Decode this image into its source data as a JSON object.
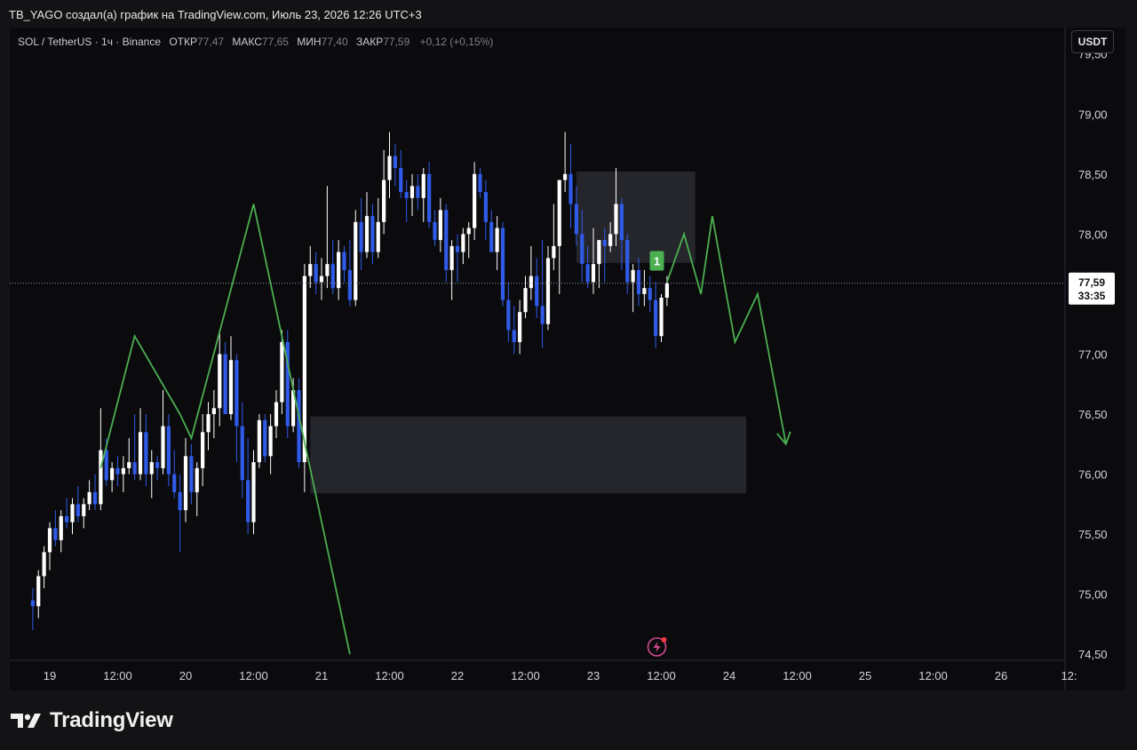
{
  "caption": "TB_YAGO создал(а) график на TradingView.com, Июль 23, 2026 12:26 UTC+3",
  "legend": {
    "symbol": "SOL / TetherUS · 1ч · Binance",
    "open_label": "ОТКР",
    "open_value": "77,47",
    "high_label": "МАКС",
    "high_value": "77,65",
    "low_label": "МИН",
    "low_value": "77,40",
    "close_label": "ЗАКР",
    "close_value": "77,59",
    "change": "+0,12 (+0,15%)"
  },
  "currency_button": "USDT",
  "price_tag": {
    "price": "77,59",
    "countdown": "33:35"
  },
  "marker_label": "1",
  "brand": "TradingView",
  "colors": {
    "up": "#ffffff",
    "down": "#2f5be8",
    "projection": "#4caf50",
    "zone": "#2a2b31",
    "marker": "#4caf50",
    "background": "#0b0b0e"
  },
  "chart_data": {
    "type": "candlestick",
    "y_ticks": [
      "79,50",
      "79,00",
      "78,50",
      "78,00",
      "77,00",
      "76,50",
      "76,00",
      "75,50",
      "75,00",
      "74,50"
    ],
    "y_tick_values": [
      79.5,
      79.0,
      78.5,
      78.0,
      77.0,
      76.5,
      76.0,
      75.5,
      75.0,
      74.5
    ],
    "ylim": [
      74.45,
      79.72
    ],
    "x_ticks": [
      "19",
      "12:00",
      "20",
      "12:00",
      "21",
      "12:00",
      "22",
      "12:00",
      "23",
      "12:00",
      "24",
      "12:00",
      "25",
      "12:00",
      "26",
      "12:"
    ],
    "x_tick_hours": [
      0,
      12,
      24,
      36,
      48,
      60,
      72,
      84,
      96,
      108,
      120,
      132,
      144,
      156,
      168,
      180
    ],
    "xlim_hours": [
      -3,
      180
    ],
    "current_price": 77.59,
    "candles": [
      {
        "t": -3,
        "o": 74.95,
        "h": 75.05,
        "l": 74.7,
        "c": 74.9
      },
      {
        "t": -2,
        "o": 74.9,
        "h": 75.2,
        "l": 74.8,
        "c": 75.15
      },
      {
        "t": -1,
        "o": 75.15,
        "h": 75.4,
        "l": 75.05,
        "c": 75.35
      },
      {
        "t": 0,
        "o": 75.35,
        "h": 75.6,
        "l": 75.2,
        "c": 75.55
      },
      {
        "t": 1,
        "o": 75.55,
        "h": 75.7,
        "l": 75.4,
        "c": 75.45
      },
      {
        "t": 2,
        "o": 75.45,
        "h": 75.7,
        "l": 75.35,
        "c": 75.65
      },
      {
        "t": 3,
        "o": 75.65,
        "h": 75.8,
        "l": 75.55,
        "c": 75.6
      },
      {
        "t": 4,
        "o": 75.6,
        "h": 75.8,
        "l": 75.5,
        "c": 75.75
      },
      {
        "t": 5,
        "o": 75.75,
        "h": 75.9,
        "l": 75.6,
        "c": 75.65
      },
      {
        "t": 6,
        "o": 75.65,
        "h": 75.8,
        "l": 75.55,
        "c": 75.75
      },
      {
        "t": 7,
        "o": 75.75,
        "h": 75.95,
        "l": 75.7,
        "c": 75.85
      },
      {
        "t": 8,
        "o": 75.85,
        "h": 76.0,
        "l": 75.7,
        "c": 75.75
      },
      {
        "t": 9,
        "o": 75.75,
        "h": 76.55,
        "l": 75.7,
        "c": 76.2
      },
      {
        "t": 10,
        "o": 76.2,
        "h": 76.3,
        "l": 75.9,
        "c": 75.95
      },
      {
        "t": 11,
        "o": 75.95,
        "h": 76.1,
        "l": 75.85,
        "c": 76.05
      },
      {
        "t": 12,
        "o": 76.05,
        "h": 76.15,
        "l": 75.9,
        "c": 76.0
      },
      {
        "t": 13,
        "o": 76.0,
        "h": 76.15,
        "l": 75.85,
        "c": 76.05
      },
      {
        "t": 14,
        "o": 76.05,
        "h": 76.3,
        "l": 76.0,
        "c": 76.1
      },
      {
        "t": 15,
        "o": 76.1,
        "h": 76.5,
        "l": 75.95,
        "c": 76.0
      },
      {
        "t": 16,
        "o": 76.0,
        "h": 76.55,
        "l": 75.95,
        "c": 76.35
      },
      {
        "t": 17,
        "o": 76.35,
        "h": 76.5,
        "l": 75.9,
        "c": 76.0
      },
      {
        "t": 18,
        "o": 76.0,
        "h": 76.2,
        "l": 75.8,
        "c": 76.1
      },
      {
        "t": 19,
        "o": 76.1,
        "h": 76.15,
        "l": 75.95,
        "c": 76.05
      },
      {
        "t": 20,
        "o": 76.05,
        "h": 76.7,
        "l": 76.0,
        "c": 76.4
      },
      {
        "t": 21,
        "o": 76.4,
        "h": 76.5,
        "l": 75.9,
        "c": 76.0
      },
      {
        "t": 22,
        "o": 76.0,
        "h": 76.2,
        "l": 75.8,
        "c": 75.85
      },
      {
        "t": 23,
        "o": 75.85,
        "h": 76.0,
        "l": 75.35,
        "c": 75.7
      },
      {
        "t": 24,
        "o": 75.7,
        "h": 76.3,
        "l": 75.6,
        "c": 76.15
      },
      {
        "t": 25,
        "o": 76.15,
        "h": 76.25,
        "l": 75.75,
        "c": 75.85
      },
      {
        "t": 26,
        "o": 75.85,
        "h": 76.1,
        "l": 75.65,
        "c": 76.05
      },
      {
        "t": 27,
        "o": 76.05,
        "h": 76.5,
        "l": 75.9,
        "c": 76.35
      },
      {
        "t": 28,
        "o": 76.35,
        "h": 76.6,
        "l": 76.2,
        "c": 76.5
      },
      {
        "t": 29,
        "o": 76.5,
        "h": 76.7,
        "l": 76.3,
        "c": 76.55
      },
      {
        "t": 30,
        "o": 76.55,
        "h": 77.2,
        "l": 76.4,
        "c": 77.0
      },
      {
        "t": 31,
        "o": 77.0,
        "h": 77.1,
        "l": 76.5,
        "c": 76.5
      },
      {
        "t": 32,
        "o": 76.5,
        "h": 77.15,
        "l": 76.45,
        "c": 76.95
      },
      {
        "t": 33,
        "o": 76.95,
        "h": 77.0,
        "l": 76.1,
        "c": 76.4
      },
      {
        "t": 34,
        "o": 76.4,
        "h": 76.6,
        "l": 75.8,
        "c": 75.95
      },
      {
        "t": 35,
        "o": 75.95,
        "h": 76.3,
        "l": 75.5,
        "c": 75.6
      },
      {
        "t": 36,
        "o": 75.6,
        "h": 76.2,
        "l": 75.5,
        "c": 76.1
      },
      {
        "t": 37,
        "o": 76.1,
        "h": 76.5,
        "l": 76.05,
        "c": 76.45
      },
      {
        "t": 38,
        "o": 76.45,
        "h": 76.5,
        "l": 76.1,
        "c": 76.15
      },
      {
        "t": 39,
        "o": 76.15,
        "h": 76.5,
        "l": 76.0,
        "c": 76.4
      },
      {
        "t": 40,
        "o": 76.4,
        "h": 76.7,
        "l": 76.3,
        "c": 76.6
      },
      {
        "t": 41,
        "o": 76.6,
        "h": 77.2,
        "l": 76.5,
        "c": 77.1
      },
      {
        "t": 42,
        "o": 77.1,
        "h": 77.2,
        "l": 76.3,
        "c": 76.4
      },
      {
        "t": 43,
        "o": 76.4,
        "h": 76.8,
        "l": 76.35,
        "c": 76.7
      },
      {
        "t": 44,
        "o": 76.7,
        "h": 76.8,
        "l": 76.05,
        "c": 76.1
      },
      {
        "t": 45,
        "o": 76.1,
        "h": 77.75,
        "l": 75.85,
        "c": 77.65
      },
      {
        "t": 46,
        "o": 77.65,
        "h": 77.9,
        "l": 77.55,
        "c": 77.75
      },
      {
        "t": 47,
        "o": 77.75,
        "h": 77.85,
        "l": 77.5,
        "c": 77.6
      },
      {
        "t": 48,
        "o": 77.6,
        "h": 77.8,
        "l": 77.45,
        "c": 77.65
      },
      {
        "t": 49,
        "o": 77.65,
        "h": 78.4,
        "l": 77.55,
        "c": 77.75
      },
      {
        "t": 50,
        "o": 77.75,
        "h": 77.95,
        "l": 77.5,
        "c": 77.55
      },
      {
        "t": 51,
        "o": 77.55,
        "h": 77.95,
        "l": 77.45,
        "c": 77.85
      },
      {
        "t": 52,
        "o": 77.85,
        "h": 77.9,
        "l": 77.6,
        "c": 77.7
      },
      {
        "t": 53,
        "o": 77.7,
        "h": 77.95,
        "l": 77.4,
        "c": 77.45
      },
      {
        "t": 54,
        "o": 77.45,
        "h": 78.2,
        "l": 77.4,
        "c": 78.1
      },
      {
        "t": 55,
        "o": 78.1,
        "h": 78.3,
        "l": 77.7,
        "c": 77.85
      },
      {
        "t": 56,
        "o": 77.85,
        "h": 78.35,
        "l": 77.8,
        "c": 78.15
      },
      {
        "t": 57,
        "o": 78.15,
        "h": 78.25,
        "l": 77.75,
        "c": 77.85
      },
      {
        "t": 58,
        "o": 77.85,
        "h": 78.3,
        "l": 77.8,
        "c": 78.1
      },
      {
        "t": 59,
        "o": 78.1,
        "h": 78.7,
        "l": 78.0,
        "c": 78.45
      },
      {
        "t": 60,
        "o": 78.45,
        "h": 78.85,
        "l": 78.3,
        "c": 78.65
      },
      {
        "t": 61,
        "o": 78.65,
        "h": 78.75,
        "l": 78.4,
        "c": 78.55
      },
      {
        "t": 62,
        "o": 78.55,
        "h": 78.7,
        "l": 78.3,
        "c": 78.35
      },
      {
        "t": 63,
        "o": 78.35,
        "h": 78.45,
        "l": 78.1,
        "c": 78.3
      },
      {
        "t": 64,
        "o": 78.3,
        "h": 78.5,
        "l": 78.15,
        "c": 78.4
      },
      {
        "t": 65,
        "o": 78.4,
        "h": 78.5,
        "l": 78.2,
        "c": 78.3
      },
      {
        "t": 66,
        "o": 78.3,
        "h": 78.55,
        "l": 78.1,
        "c": 78.5
      },
      {
        "t": 67,
        "o": 78.5,
        "h": 78.6,
        "l": 78.05,
        "c": 78.1
      },
      {
        "t": 68,
        "o": 78.1,
        "h": 78.2,
        "l": 77.9,
        "c": 77.95
      },
      {
        "t": 69,
        "o": 77.95,
        "h": 78.3,
        "l": 77.85,
        "c": 78.2
      },
      {
        "t": 70,
        "o": 78.2,
        "h": 78.25,
        "l": 77.6,
        "c": 77.7
      },
      {
        "t": 71,
        "o": 77.7,
        "h": 77.95,
        "l": 77.45,
        "c": 77.9
      },
      {
        "t": 72,
        "o": 77.9,
        "h": 78.0,
        "l": 77.6,
        "c": 77.85
      },
      {
        "t": 73,
        "o": 77.85,
        "h": 78.05,
        "l": 77.75,
        "c": 78.0
      },
      {
        "t": 74,
        "o": 78.0,
        "h": 78.1,
        "l": 77.8,
        "c": 78.05
      },
      {
        "t": 75,
        "o": 78.05,
        "h": 78.6,
        "l": 77.95,
        "c": 78.5
      },
      {
        "t": 76,
        "o": 78.5,
        "h": 78.55,
        "l": 78.3,
        "c": 78.35
      },
      {
        "t": 77,
        "o": 78.35,
        "h": 78.45,
        "l": 77.95,
        "c": 78.1
      },
      {
        "t": 78,
        "o": 78.1,
        "h": 78.2,
        "l": 77.85,
        "c": 77.85
      },
      {
        "t": 79,
        "o": 77.85,
        "h": 78.15,
        "l": 77.7,
        "c": 78.05
      },
      {
        "t": 80,
        "o": 78.05,
        "h": 78.1,
        "l": 77.4,
        "c": 77.45
      },
      {
        "t": 81,
        "o": 77.45,
        "h": 77.6,
        "l": 77.1,
        "c": 77.2
      },
      {
        "t": 82,
        "o": 77.2,
        "h": 77.4,
        "l": 77.0,
        "c": 77.1
      },
      {
        "t": 83,
        "o": 77.1,
        "h": 77.45,
        "l": 77.0,
        "c": 77.35
      },
      {
        "t": 84,
        "o": 77.35,
        "h": 77.65,
        "l": 77.3,
        "c": 77.55
      },
      {
        "t": 85,
        "o": 77.55,
        "h": 77.9,
        "l": 77.45,
        "c": 77.65
      },
      {
        "t": 86,
        "o": 77.65,
        "h": 77.8,
        "l": 77.3,
        "c": 77.4
      },
      {
        "t": 87,
        "o": 77.4,
        "h": 77.95,
        "l": 77.05,
        "c": 77.25
      },
      {
        "t": 88,
        "o": 77.25,
        "h": 77.9,
        "l": 77.2,
        "c": 77.8
      },
      {
        "t": 89,
        "o": 77.8,
        "h": 78.25,
        "l": 77.7,
        "c": 77.9
      },
      {
        "t": 90,
        "o": 77.9,
        "h": 78.35,
        "l": 77.5,
        "c": 78.45
      },
      {
        "t": 91,
        "o": 78.45,
        "h": 78.85,
        "l": 78.35,
        "c": 78.5
      },
      {
        "t": 92,
        "o": 78.5,
        "h": 78.75,
        "l": 78.05,
        "c": 78.25
      },
      {
        "t": 93,
        "o": 78.25,
        "h": 78.4,
        "l": 77.9,
        "c": 78.0
      },
      {
        "t": 94,
        "o": 78.0,
        "h": 78.2,
        "l": 77.6,
        "c": 77.75
      },
      {
        "t": 95,
        "o": 77.75,
        "h": 77.9,
        "l": 77.55,
        "c": 77.6
      },
      {
        "t": 96,
        "o": 77.6,
        "h": 78.05,
        "l": 77.5,
        "c": 77.75
      },
      {
        "t": 97,
        "o": 77.75,
        "h": 77.9,
        "l": 77.55,
        "c": 77.95
      },
      {
        "t": 98,
        "o": 77.95,
        "h": 78.05,
        "l": 77.6,
        "c": 77.9
      },
      {
        "t": 99,
        "o": 77.9,
        "h": 78.1,
        "l": 77.85,
        "c": 78.0
      },
      {
        "t": 100,
        "o": 78.0,
        "h": 78.55,
        "l": 77.9,
        "c": 78.25
      },
      {
        "t": 101,
        "o": 78.25,
        "h": 78.3,
        "l": 77.7,
        "c": 77.95
      },
      {
        "t": 102,
        "o": 77.95,
        "h": 78.0,
        "l": 77.5,
        "c": 77.6
      },
      {
        "t": 103,
        "o": 77.6,
        "h": 77.75,
        "l": 77.35,
        "c": 77.7
      },
      {
        "t": 104,
        "o": 77.7,
        "h": 77.8,
        "l": 77.4,
        "c": 77.5
      },
      {
        "t": 105,
        "o": 77.5,
        "h": 77.7,
        "l": 77.4,
        "c": 77.55
      },
      {
        "t": 106,
        "o": 77.55,
        "h": 77.65,
        "l": 77.35,
        "c": 77.45
      },
      {
        "t": 107,
        "o": 77.45,
        "h": 77.6,
        "l": 77.05,
        "c": 77.15
      },
      {
        "t": 108,
        "o": 77.15,
        "h": 77.5,
        "l": 77.1,
        "c": 77.47
      },
      {
        "t": 109,
        "o": 77.47,
        "h": 77.65,
        "l": 77.4,
        "c": 77.59
      }
    ],
    "zones": [
      {
        "t_start": 93,
        "t_end": 114,
        "price_high": 78.52,
        "price_low": 77.76
      },
      {
        "t_start": 46,
        "t_end": 123,
        "price_high": 76.48,
        "price_low": 75.84
      }
    ],
    "projections": [
      [
        {
          "t": 9,
          "p": 76.05
        },
        {
          "t": 15,
          "p": 77.15
        },
        {
          "t": 23,
          "p": 76.5
        },
        {
          "t": 25,
          "p": 76.3
        },
        {
          "t": 36,
          "p": 78.25
        },
        {
          "t": 53,
          "p": 74.5
        }
      ],
      [
        {
          "t": 109,
          "p": 77.6
        },
        {
          "t": 112,
          "p": 78.0
        },
        {
          "t": 115,
          "p": 77.5
        },
        {
          "t": 117,
          "p": 78.15
        },
        {
          "t": 121,
          "p": 77.1
        },
        {
          "t": 125,
          "p": 77.5
        },
        {
          "t": 130,
          "p": 76.25
        }
      ]
    ],
    "marker": {
      "t": 108,
      "p": 77.77
    },
    "event_icon_t": 108
  }
}
